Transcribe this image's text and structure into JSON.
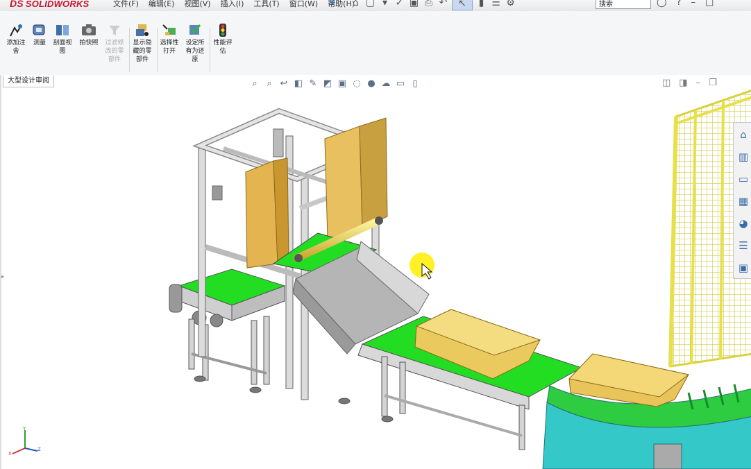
{
  "app": {
    "logo_ds": "DS",
    "logo_text": "SOLIDWORKS",
    "brand_color": "#c8102e"
  },
  "menu": [
    "文件(F)",
    "编辑(E)",
    "视图(V)",
    "插入(I)",
    "工具(T)",
    "窗口(W)",
    "帮助(H)"
  ],
  "search": {
    "placeholder": "搜索"
  },
  "ribbon": {
    "tools": [
      {
        "label": "添加注\n舍",
        "icon": "add-annotation-icon",
        "enabled": true
      },
      {
        "label": "测量",
        "icon": "measure-icon",
        "enabled": true
      },
      {
        "label": "剖面视\n图",
        "icon": "section-view-icon",
        "enabled": true
      },
      {
        "label": "拍快照",
        "icon": "snapshot-icon",
        "enabled": true
      },
      {
        "label": "过滤修\n改的零\n部件",
        "icon": "filter-modified-icon",
        "enabled": false
      },
      {
        "label": "显示隐\n藏的零\n部件",
        "icon": "show-hidden-icon",
        "enabled": true
      },
      {
        "label": "选择性\n打开",
        "icon": "selective-open-icon",
        "enabled": true
      },
      {
        "label": "设定所\n有为还\n原",
        "icon": "set-resolved-icon",
        "enabled": true
      },
      {
        "label": "性能评\n估",
        "icon": "performance-icon",
        "enabled": true
      }
    ],
    "active_tab": "大型设计审阅"
  },
  "colors": {
    "conveyor_green": "#22dd22",
    "frame_gray": "#d4d4d4",
    "box_yellow": "#ecc85c",
    "fence_yellow": "#e6e04a",
    "curve_cyan": "#35c8c8",
    "cursor_highlight": "#ffee00"
  }
}
